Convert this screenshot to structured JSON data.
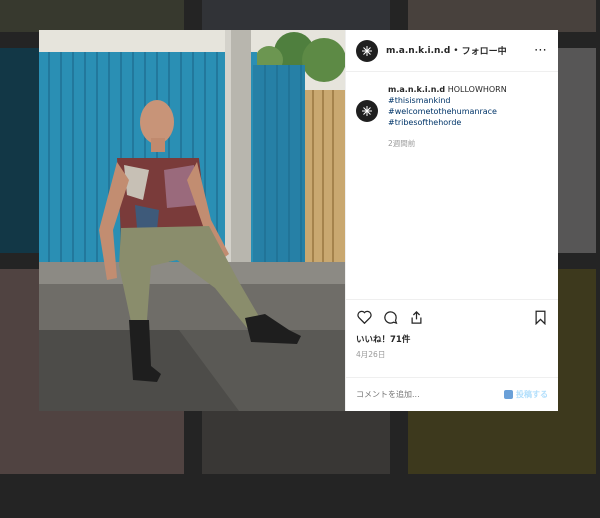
{
  "post": {
    "username": "m.a.n.k.i.n.d",
    "separator": "•",
    "follow_status": "フォロー中",
    "more_icon": "more-horizontal-icon",
    "caption_user": "m.a.n.k.i.n.d",
    "caption_text": "HOLLOWHORN",
    "hashtags": [
      "#thisismankind",
      "#welcometothehumanrace",
      "#tribesofthehorde"
    ],
    "caption_time": "2週間前",
    "likes": "いいね！71件",
    "date": "4月26日",
    "comment_placeholder": "コメントを追加...",
    "post_button": "投稿する"
  },
  "icons": {
    "like": "heart-icon",
    "comment": "comment-icon",
    "share": "share-icon",
    "save": "bookmark-icon",
    "avatar": "mankind-logo-icon"
  },
  "colors": {
    "wall_blue": "#2a8fb4",
    "hashtag": "#003569",
    "muted": "#999999",
    "post_button": "#b2dffc"
  }
}
